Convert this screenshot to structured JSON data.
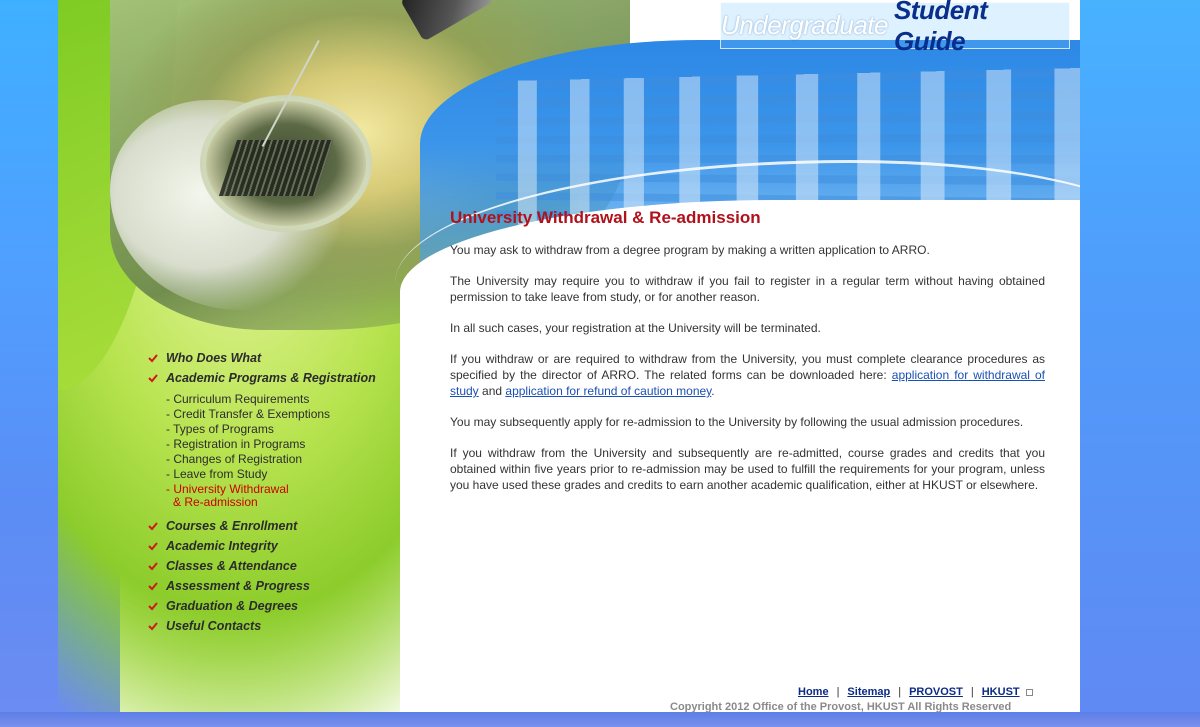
{
  "header": {
    "title_light": "Undergraduate",
    "title_bold": "Student Guide"
  },
  "nav": {
    "items_top": [
      {
        "label": "Who Does What"
      },
      {
        "label": "Academic Programs & Registration"
      }
    ],
    "subitems": [
      {
        "label": "- Curriculum Requirements",
        "active": false
      },
      {
        "label": "- Credit Transfer & Exemptions",
        "active": false
      },
      {
        "label": "- Types of Programs",
        "active": false
      },
      {
        "label": "- Registration in Programs",
        "active": false
      },
      {
        "label": "- Changes of Registration",
        "active": false
      },
      {
        "label": "- Leave from Study",
        "active": false
      },
      {
        "label": "- University Withdrawal",
        "active": true
      },
      {
        "label": "& Re-admission",
        "active": true
      }
    ],
    "items_bottom": [
      {
        "label": "Courses & Enrollment"
      },
      {
        "label": "Academic Integrity"
      },
      {
        "label": "Classes & Attendance"
      },
      {
        "label": "Assessment & Progress"
      },
      {
        "label": "Graduation & Degrees"
      },
      {
        "label": "Useful Contacts"
      }
    ]
  },
  "main": {
    "title": "University Withdrawal & Re-admission",
    "p1": "You may ask to withdraw from a degree program by making a written application to ARRO.",
    "p2": "The University may require you to withdraw if you fail to register in a regular term without having obtained permission to take leave from study, or for another reason.",
    "p3": "In all such cases, your registration at the University will be terminated.",
    "p4_before": "If you withdraw or are required to withdraw from the University, you must complete clearance procedures as specified by the director of ARRO. The related forms can be downloaded here: ",
    "p4_link1": "application for withdrawal of study",
    "p4_and": " and ",
    "p4_link2": "application for refund of caution money",
    "p4_after": ".",
    "p5": "You may subsequently apply for re-admission to the University by following the usual admission procedures.",
    "p6": "If you withdraw from the University and subsequently are re-admitted, course grades and credits that you obtained within five years prior to re-admission may be used to fulfill the requirements for your program, unless you have used these grades and credits to earn another academic qualification, either at HKUST or elsewhere."
  },
  "footer": {
    "home": "Home",
    "sitemap": "Sitemap",
    "provost": "PROVOST",
    "hkust": "HKUST",
    "separator": "|",
    "copyright": "Copyright 2012 Office of the Provost, HKUST   All Rights Reserved"
  },
  "colors": {
    "title_red": "#b0121b",
    "link_blue": "#1a4fb5",
    "active_red": "#cc0000",
    "nav_check_red": "#cc1a1a"
  }
}
